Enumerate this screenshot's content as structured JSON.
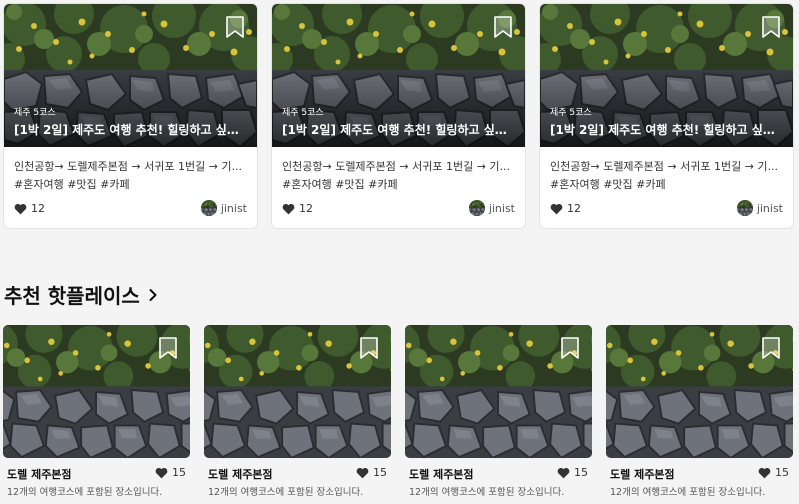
{
  "course_cards": [
    {
      "count_label": "제주 5코스",
      "title": "[1박 2일] 제주도 여행 추천! 힐링하고 싶은 ...",
      "route": "인천공항→ 도렐제주본점 → 서귀포 1번길 → 기...",
      "tags": "#혼자여행 #맛집 #카페",
      "likes": "12",
      "author": "jinist"
    },
    {
      "count_label": "제주 5코스",
      "title": "[1박 2일] 제주도 여행 추천! 힐링하고 싶은 ...",
      "route": "인천공항→ 도렐제주본점 → 서귀포 1번길 → 기...",
      "tags": "#혼자여행 #맛집 #카페",
      "likes": "12",
      "author": "jinist"
    },
    {
      "count_label": "제주 5코스",
      "title": "[1박 2일] 제주도 여행 추천! 힐링하고 싶은 ...",
      "route": "인천공항→ 도렐제주본점 → 서귀포 1번길 → 기...",
      "tags": "#혼자여행 #맛집 #카페",
      "likes": "12",
      "author": "jinist"
    }
  ],
  "section": {
    "title": "추천 핫플레이스",
    "arrow_icon": "chevron-right-icon"
  },
  "place_cards": [
    {
      "name": "도렐 제주본점",
      "likes": "15",
      "desc": "12개의 여행코스에 포함된 장소입니다."
    },
    {
      "name": "도렐 제주본점",
      "likes": "15",
      "desc": "12개의 여행코스에 포함된 장소입니다."
    },
    {
      "name": "도렐 제주본점",
      "likes": "15",
      "desc": "12개의 여행코스에 포함된 장소입니다."
    },
    {
      "name": "도렐 제주본점",
      "likes": "15",
      "desc": "12개의 여행코스에 포함된 장소입니다."
    }
  ],
  "icons": {
    "like": "heart-icon",
    "bookmark": "bookmark-icon"
  },
  "colors": {
    "background": "#f4f4f4",
    "card": "#ffffff",
    "text": "#222222",
    "icon": "#333333"
  }
}
